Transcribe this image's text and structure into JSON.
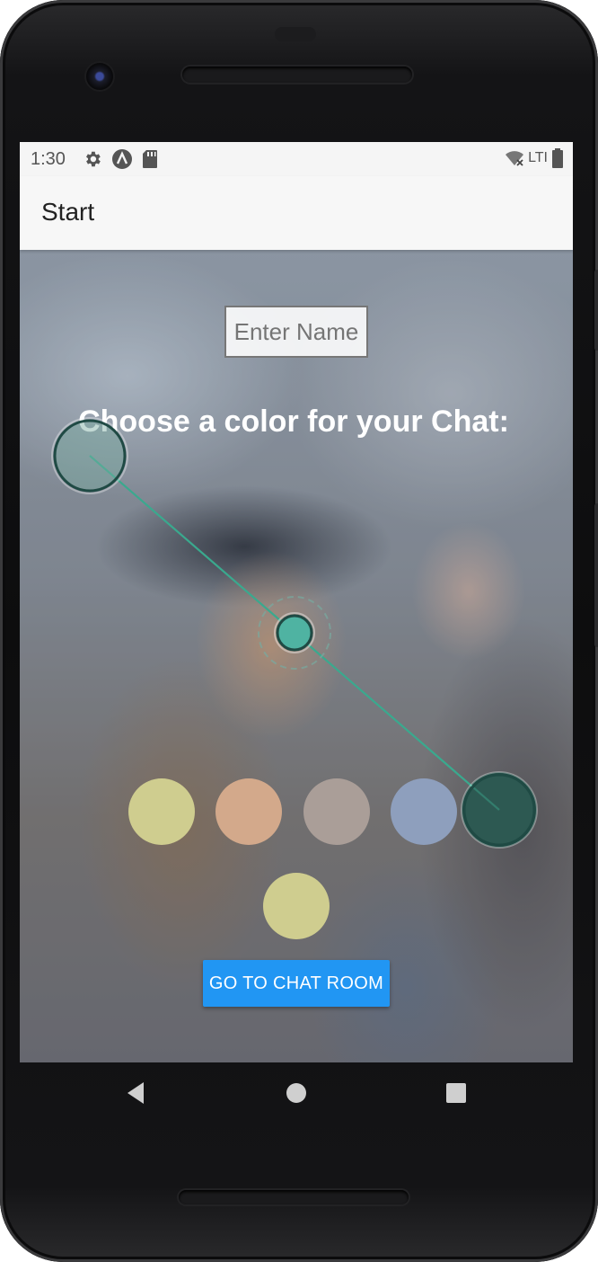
{
  "status_bar": {
    "time": "1:30",
    "left_icons": [
      "gear-icon",
      "android-a-icon",
      "sd-card-icon"
    ],
    "network_label": "LTI",
    "right_icons": [
      "wifi-off-icon",
      "battery-icon"
    ]
  },
  "app_bar": {
    "title": "Start"
  },
  "form": {
    "name_placeholder": "Enter Name",
    "choose_label": "Choose a color for your Chat:"
  },
  "color_options": [
    {
      "name": "yellow-green",
      "hex": "#cfcd8f"
    },
    {
      "name": "peach",
      "hex": "#d3a98b"
    },
    {
      "name": "taupe",
      "hex": "#aa9e98"
    },
    {
      "name": "blue-grey",
      "hex": "#8e9fbd"
    },
    {
      "name": "dark-teal",
      "hex": "#2d5a52"
    },
    {
      "name": "yellow-green-2",
      "hex": "#cfcd8f"
    }
  ],
  "button": {
    "label": "GO TO CHAT ROOM",
    "color": "#2196f3"
  },
  "gesture": {
    "description_icons": [
      "pinch-start-touch-icon",
      "pinch-center-touch-icon",
      "pinch-end-touch-icon"
    ],
    "accent": "#3aa98e"
  },
  "nav_bar": {
    "icons": [
      "back-icon",
      "home-icon",
      "recents-icon"
    ]
  }
}
